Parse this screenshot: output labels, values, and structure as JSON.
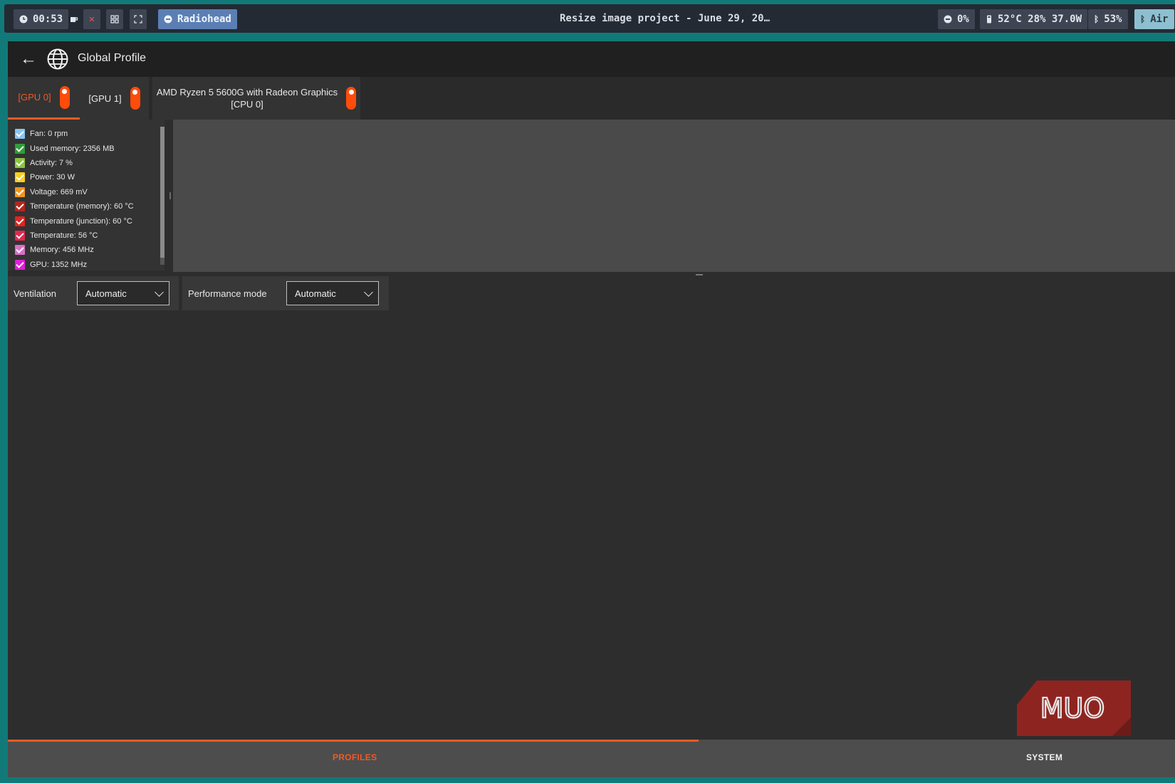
{
  "topbar": {
    "clock": "00:53",
    "app_chip": "Radiohead",
    "window_title": "Resize image project - June 29, 20…",
    "cpu_usage": "0%",
    "system_stats": "52°C 28% 37.0W",
    "bluetooth": "53%",
    "audio_device": "Air"
  },
  "header": {
    "title": "Global Profile"
  },
  "device_tabs": [
    {
      "label": "[GPU 0]",
      "active": true,
      "enabled": true
    },
    {
      "label": "[GPU 1]",
      "active": false,
      "enabled": true
    },
    {
      "label_line1": "AMD Ryzen 5 5600G with Radeon Graphics",
      "label_line2": "[CPU 0]",
      "active": false,
      "enabled": true
    }
  ],
  "sensors": [
    {
      "label": "Fan: 0 rpm",
      "color": "#8ac4f0",
      "checked": true
    },
    {
      "label": "Used memory: 2356 MB",
      "color": "#2e9e3a",
      "checked": true
    },
    {
      "label": "Activity: 7 %",
      "color": "#8cc540",
      "checked": true
    },
    {
      "label": "Power: 30 W",
      "color": "#f6cf1f",
      "checked": true
    },
    {
      "label": "Voltage: 669 mV",
      "color": "#f0961e",
      "checked": true
    },
    {
      "label": "Temperature (memory): 60 °C",
      "color": "#b3261e",
      "checked": true
    },
    {
      "label": "Temperature (junction): 60 °C",
      "color": "#e32222",
      "checked": true
    },
    {
      "label": "Temperature: 56 °C",
      "color": "#e32650",
      "checked": true
    },
    {
      "label": "Memory: 456 MHz",
      "color": "#d86fc8",
      "checked": true
    },
    {
      "label": "GPU: 1352 MHz",
      "color": "#e21ed8",
      "checked": true
    }
  ],
  "controls": {
    "ventilation_label": "Ventilation",
    "ventilation_value": "Automatic",
    "performance_label": "Performance mode",
    "performance_value": "Automatic"
  },
  "bottom_nav": {
    "profiles_label": "PROFILES",
    "system_label": "SYSTEM",
    "active": "PROFILES"
  },
  "watermark": {
    "text": "MUO",
    "color": "#8e2420"
  },
  "colors": {
    "accent": "#f05a24",
    "toggle": "#ff4c0a",
    "desktop": "#117a78"
  }
}
